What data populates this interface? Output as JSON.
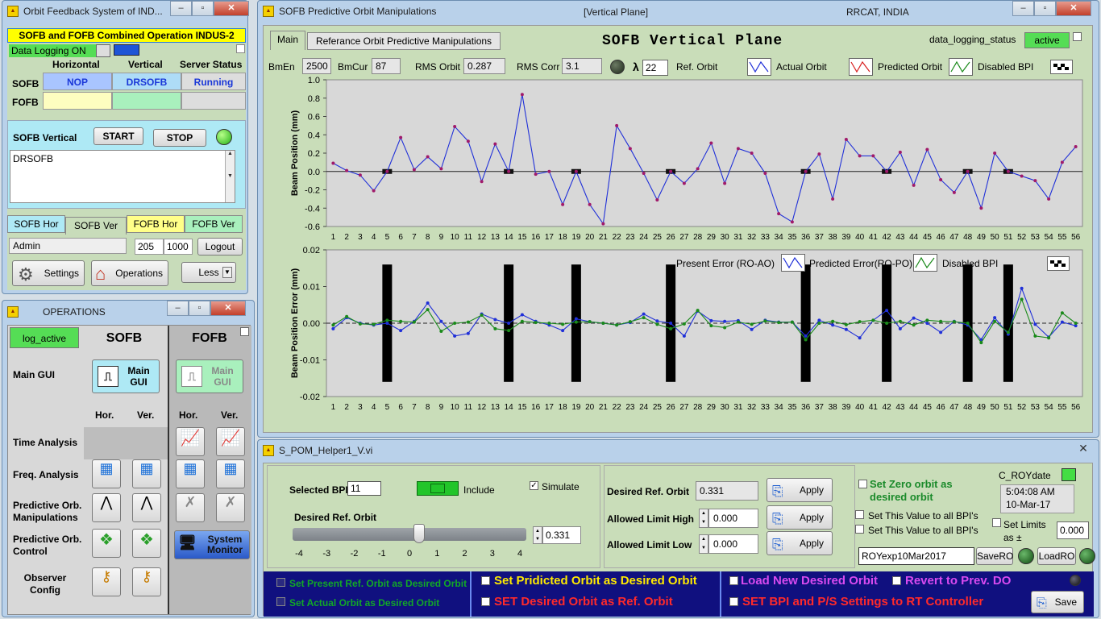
{
  "desktop_bg": "#d6dfe6",
  "w1": {
    "title": "Orbit Feedback System of IND...",
    "header": "SOFB and FOFB Combined Operation INDUS-2",
    "data_logging": "Data Logging ON",
    "col_h": "Horizontal",
    "col_v": "Vertical",
    "col_s": "Server Status",
    "row_sofb": "SOFB",
    "row_fofb": "FOFB",
    "sofb_h": "NOP",
    "sofb_v": "DRSOFB",
    "sofb_s": "Running",
    "section": "SOFB Vertical",
    "start": "START",
    "stop": "STOP",
    "log_text": "DRSOFB",
    "tabs": [
      "SOFB Hor",
      "SOFB Ver",
      "FOFB Hor",
      "FOFB Ver"
    ],
    "user": "Admin",
    "n1": "205",
    "n2": "1000",
    "logout": "Logout",
    "settings": "Settings",
    "operations": "Operations",
    "less": "Less"
  },
  "w2": {
    "title": "OPERATIONS",
    "log_active": "log_active",
    "sofb": "SOFB",
    "fofb": "FOFB",
    "hor": "Hor.",
    "ver": "Ver.",
    "rows": [
      "Main GUI",
      "Time Analysis",
      "Freq. Analysis",
      "Predictive Orb. Manipulations",
      "Predictive Orb. Control",
      "Observer Config"
    ],
    "main_gui": "Main GUI",
    "system_monitor": "System Monitor"
  },
  "w3": {
    "title": "SOFB Predictive Orbit Manipulations",
    "title_mid": "[Vertical Plane]",
    "title_right": "RRCAT, INDIA",
    "tab_main": "Main",
    "tab_ref": "Referance Orbit Predictive Manipulations",
    "plane_title": "SOFB  Vertical  Plane",
    "dl_status_label": "data_logging_status",
    "dl_status": "active",
    "bmen_label": "BmEn",
    "bmen": "2500",
    "bmcur_label": "BmCur",
    "bmcur": "87",
    "rms_orbit_label": "RMS Orbit",
    "rms_orbit": "0.287",
    "rms_corr_label": "RMS Corr",
    "rms_corr": "3.1",
    "lambda_label": "λ",
    "lambda": "22",
    "ref_orbit": "Ref. Orbit",
    "leg_actual": "Actual Orbit",
    "leg_pred": "Predicted Orbit",
    "leg_dis": "Disabled BPI",
    "leg2_present": "Present Error (RO-AO)",
    "leg2_pred": "Predicted Error(RO-PO)",
    "leg2_dis": "Disabled BPI"
  },
  "w4": {
    "title": "S_POM_Helper1_V.vi",
    "selected_bpi_label": "Selected BPI",
    "selected_bpi": "11",
    "include": "Include",
    "simulate": "Simulate",
    "desired_label": "Desired Ref. Orbit",
    "slider_value": "0.331",
    "slider_ticks": [
      "-4",
      "-3",
      "-2",
      "-1",
      "0",
      "1",
      "2",
      "3",
      "4"
    ],
    "dro_label": "Desired Ref. Orbit",
    "dro": "0.331",
    "alh_label": "Allowed Limit High",
    "alh": "0.000",
    "all_label": "Allowed Limit Low",
    "all": "0.000",
    "apply": "Apply",
    "set_zero": "Set Zero orbit as desired orbit",
    "set_all1": "Set This Value to all BPI's",
    "set_all2": "Set This Value to all BPI's",
    "croy": "C_ROYdate",
    "time": "5:04:08 AM",
    "date": "10-Mar-17",
    "set_limits": "Set Limits as ±",
    "limits_val": "0.000",
    "file": "ROYexp10Mar2017",
    "savero": "SaveRO",
    "loadro": "LoadRO",
    "b1": "Set Present Ref. Orbit as Desired Orbit",
    "b2": "Set Actual Orbit as Desired Orbit",
    "b3": "Set Pridicted Orbit as Desired Orbit",
    "b4": "SET Desired Orbit as  Ref. Orbit",
    "b5": "Load New Desired Orbit",
    "b6": "Revert to Prev. DO",
    "b7": "SET BPI and P/S Settings to RT Controller",
    "save": "Save"
  },
  "chart_data": [
    {
      "type": "line",
      "ylabel": "Beam Position (mm)",
      "ylim": [
        -0.6,
        1.0
      ],
      "yticks": [
        "1.0",
        "0.8",
        "0.6",
        "0.4",
        "0.2",
        "0.0",
        "-0.2",
        "-0.4",
        "-0.6"
      ],
      "x": [
        1,
        2,
        3,
        4,
        5,
        6,
        7,
        8,
        9,
        10,
        11,
        12,
        13,
        14,
        15,
        16,
        17,
        18,
        19,
        20,
        21,
        22,
        23,
        24,
        25,
        26,
        27,
        28,
        29,
        30,
        31,
        32,
        33,
        34,
        35,
        36,
        37,
        38,
        39,
        40,
        41,
        42,
        43,
        44,
        45,
        46,
        47,
        48,
        49,
        50,
        51,
        52,
        53,
        54,
        55,
        56
      ],
      "series": [
        {
          "name": "Actual Orbit",
          "values": [
            0.09,
            0.01,
            -0.04,
            -0.21,
            0.0,
            0.37,
            0.02,
            0.16,
            0.03,
            0.49,
            0.33,
            -0.11,
            0.3,
            0.0,
            0.84,
            -0.03,
            0.0,
            -0.36,
            0.0,
            -0.36,
            -0.57,
            0.5,
            0.25,
            -0.02,
            -0.31,
            0.0,
            -0.13,
            0.03,
            0.31,
            -0.13,
            0.25,
            0.2,
            -0.02,
            -0.46,
            -0.55,
            0.0,
            0.19,
            -0.3,
            0.35,
            0.17,
            0.17,
            0.0,
            0.21,
            -0.15,
            0.24,
            -0.09,
            -0.23,
            0.0,
            -0.4,
            0.2,
            0.0,
            -0.05,
            -0.1,
            -0.3,
            0.1,
            0.27
          ]
        }
      ],
      "disabled": [
        5,
        14,
        19,
        26,
        36,
        42,
        48,
        51
      ]
    },
    {
      "type": "line",
      "ylabel": "Beam Position Error (mm)",
      "ylim": [
        -0.02,
        0.02
      ],
      "yticks": [
        "0.02",
        "0.01",
        "0.00",
        "-0.01",
        "-0.02"
      ],
      "series": [
        {
          "name": "Predicted Error(RO-PO)",
          "values": [
            -0.0015,
            0.0015,
            0.0,
            -0.0005,
            0.0,
            -0.002,
            0.0005,
            0.0055,
            0.0005,
            -0.0035,
            -0.0028,
            0.0025,
            0.001,
            0.0,
            0.0023,
            0.0005,
            -0.0005,
            -0.002,
            0.0012,
            0.0004,
            0.0,
            -0.0005,
            0.0002,
            0.0025,
            0.0006,
            0.0,
            -0.0035,
            0.0033,
            0.0007,
            0.0005,
            0.0007,
            -0.0017,
            0.0008,
            0.0003,
            0.0003,
            -0.0035,
            0.0008,
            -0.0005,
            -0.0017,
            -0.004,
            0.0008,
            0.0035,
            -0.0015,
            0.0014,
            0.0,
            -0.0025,
            0.0005,
            -0.0005,
            -0.0045,
            0.0015,
            -0.003,
            0.0095,
            -0.0003,
            -0.0038,
            0.0003,
            -0.0007
          ]
        },
        {
          "name": "Disabled BPI",
          "values": [
            -0.0005,
            0.0018,
            -0.0002,
            -0.0003,
            0.0008,
            0.0005,
            0.0003,
            0.0037,
            -0.0022,
            0.0,
            0.0003,
            0.0022,
            -0.0015,
            -0.002,
            0.0005,
            0.0002,
            0.0,
            -0.0003,
            0.0003,
            0.0004,
            0.0,
            -0.0005,
            0.0004,
            0.0015,
            -0.0003,
            -0.0015,
            -0.0002,
            0.0035,
            -0.0007,
            -0.0012,
            0.0003,
            -0.0003,
            0.0006,
            0.0002,
            0.0003,
            -0.0045,
            0.0,
            0.0005,
            -0.0004,
            0.0004,
            0.0008,
            0.0,
            0.0005,
            -0.0005,
            0.0008,
            0.0005,
            0.0004,
            0.0,
            -0.0053,
            0.0005,
            -0.0025,
            0.0065,
            -0.0035,
            -0.004,
            0.0028,
            0.0
          ]
        }
      ],
      "disabled": [
        5,
        14,
        19,
        26,
        36,
        42,
        48,
        51
      ]
    }
  ]
}
